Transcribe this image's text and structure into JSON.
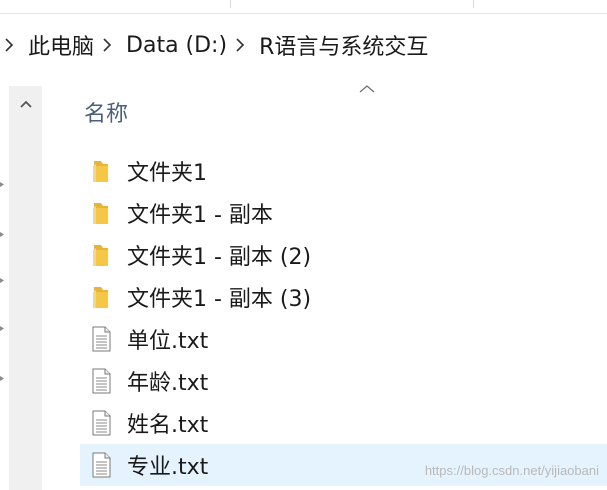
{
  "breadcrumb": {
    "items": [
      "此电脑",
      "Data (D:)",
      "R语言与系统交互"
    ]
  },
  "column_header": "名称",
  "files": [
    {
      "name": "文件夹1",
      "type": "folder-icon"
    },
    {
      "name": "文件夹1 - 副本",
      "type": "folder-icon"
    },
    {
      "name": "文件夹1 - 副本 (2)",
      "type": "folder-icon"
    },
    {
      "name": "文件夹1 - 副本 (3)",
      "type": "folder-icon"
    },
    {
      "name": "单位.txt",
      "type": "text-file-icon"
    },
    {
      "name": "年龄.txt",
      "type": "text-file-icon"
    },
    {
      "name": "姓名.txt",
      "type": "text-file-icon"
    },
    {
      "name": "专业.txt",
      "type": "text-file-icon",
      "selected": true
    }
  ],
  "watermark": "https://blog.csdn.net/yijiaobani",
  "colors": {
    "selection": "#e5f3ff",
    "header_text": "#4c607a",
    "folder": "#f5c748"
  }
}
